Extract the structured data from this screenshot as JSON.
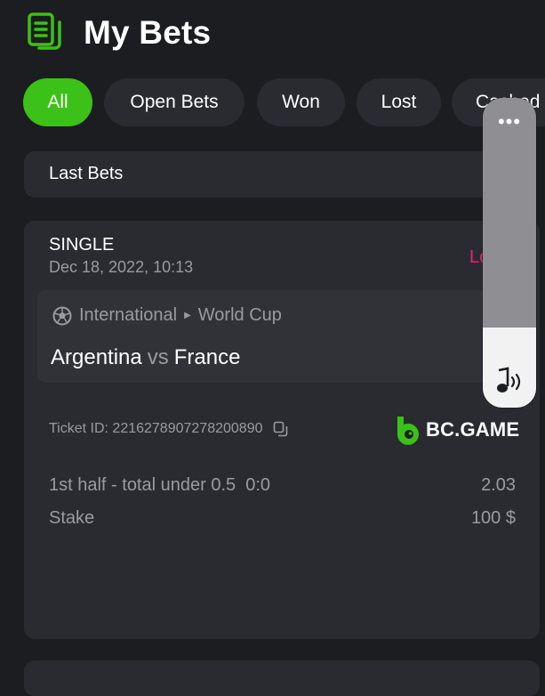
{
  "header": {
    "title": "My Bets",
    "icon": "betslip-icon",
    "accent_color": "#3bc117"
  },
  "filters": [
    {
      "label": "All",
      "active": true
    },
    {
      "label": "Open Bets",
      "active": false
    },
    {
      "label": "Won",
      "active": false
    },
    {
      "label": "Lost",
      "active": false
    },
    {
      "label": "Cashed",
      "active": false
    }
  ],
  "section": {
    "title": "Last Bets"
  },
  "bet": {
    "type": "SINGLE",
    "date": "Dec 18, 2022, 10:13",
    "status": "Lost",
    "status_color": "#e8237a",
    "sport_icon": "soccer-ball-icon",
    "category": "International",
    "league": "World Cup",
    "team_home": "Argentina",
    "vs": "vs",
    "team_away": "France",
    "ticket_label": "Ticket ID: 2216278907278200890",
    "brand": "BC.GAME",
    "selection": "1st half - total under 0.5  0:0",
    "odds": "2.03",
    "stake_label": "Stake",
    "stake_value": "100 $"
  },
  "volume_overlay": {
    "more": "•••",
    "level": 0.26,
    "icon": "music-note-icon"
  }
}
